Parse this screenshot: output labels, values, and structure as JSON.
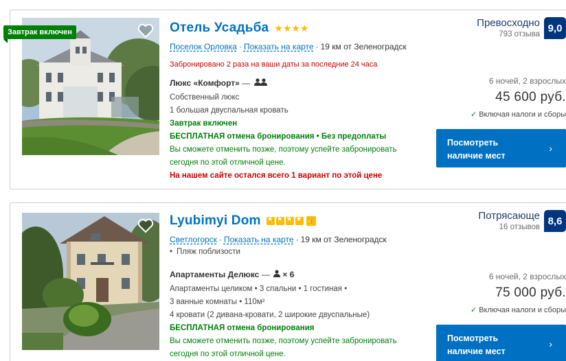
{
  "listings": [
    {
      "ribbon": "Завтрак включен",
      "name": "Отель Усадьба",
      "stars_glyph": "★★★★",
      "location_link": "Поселок Орловка",
      "map_link": "Показать на карте",
      "distance": "19 км от Зеленоградск",
      "booked_notice": "Забронировано 2 раза на ваши даты за последние 24 часа",
      "room_name": "Люкс «Комфорт»",
      "room_dash": "—",
      "room_detail_1": "Собственный люкс",
      "room_detail_2": "1 большая двуспальная кровать",
      "breakfast": "Завтрак включен",
      "cancellation": "БЕСПЛАТНАЯ отмена бронирования • Без предоплаты",
      "cancel_note_1": "Вы сможете отменить позже, поэтому успейте забронировать",
      "cancel_note_2": "сегодня по этой отличной цене.",
      "scarcity": "На нашем сайте остался всего 1 вариант по этой цене",
      "review_word": "Превосходно",
      "review_count": "793 отзыва",
      "score": "9,0",
      "nights": "6 ночей, 2 взрослых",
      "price": "45 600 руб.",
      "taxes": "Включая налоги и сборы",
      "button_line1": "Посмотреть",
      "button_line2": "наличие мест"
    },
    {
      "name": "Lyubimyi Dom",
      "location_link": "Светлогорск",
      "map_link": "Показать на карте",
      "distance": "19 км от Зеленоградск",
      "beach": "Пляж поблизости",
      "room_name": "Апартаменты Делюкс",
      "room_dash": "—",
      "room_guests": "× 6",
      "room_detail_1": "Апартаменты целиком  • 3 спальни • 1 гостиная •",
      "room_detail_2": "3 ванные комнаты • 110м²",
      "room_detail_3": "4 кровати (2 дивана-кровати, 2 широкие двуспальные)",
      "cancellation": "БЕСПЛАТНАЯ отмена бронирования",
      "cancel_note_1": "Вы сможете отменить позже, поэтому успейте забронировать",
      "cancel_note_2": "сегодня по этой отличной цене.",
      "review_word": "Потрясающе",
      "review_count": "16 отзывов",
      "score": "8,6",
      "nights": "6 ночей, 2 взрослых",
      "price": "75 000 руб.",
      "taxes": "Включая налоги и сборы",
      "button_line1": "Посмотреть",
      "button_line2": "наличие мест"
    }
  ],
  "colors": {
    "brand_blue": "#0071c2",
    "score_bg": "#003580",
    "green": "#008009",
    "red": "#cc0000",
    "star": "#febb02"
  },
  "icons": [
    "heart-icon",
    "star-icon",
    "two-persons-icon",
    "person-icon",
    "thumbs-up-icon",
    "check-icon",
    "chevron-right-icon"
  ]
}
